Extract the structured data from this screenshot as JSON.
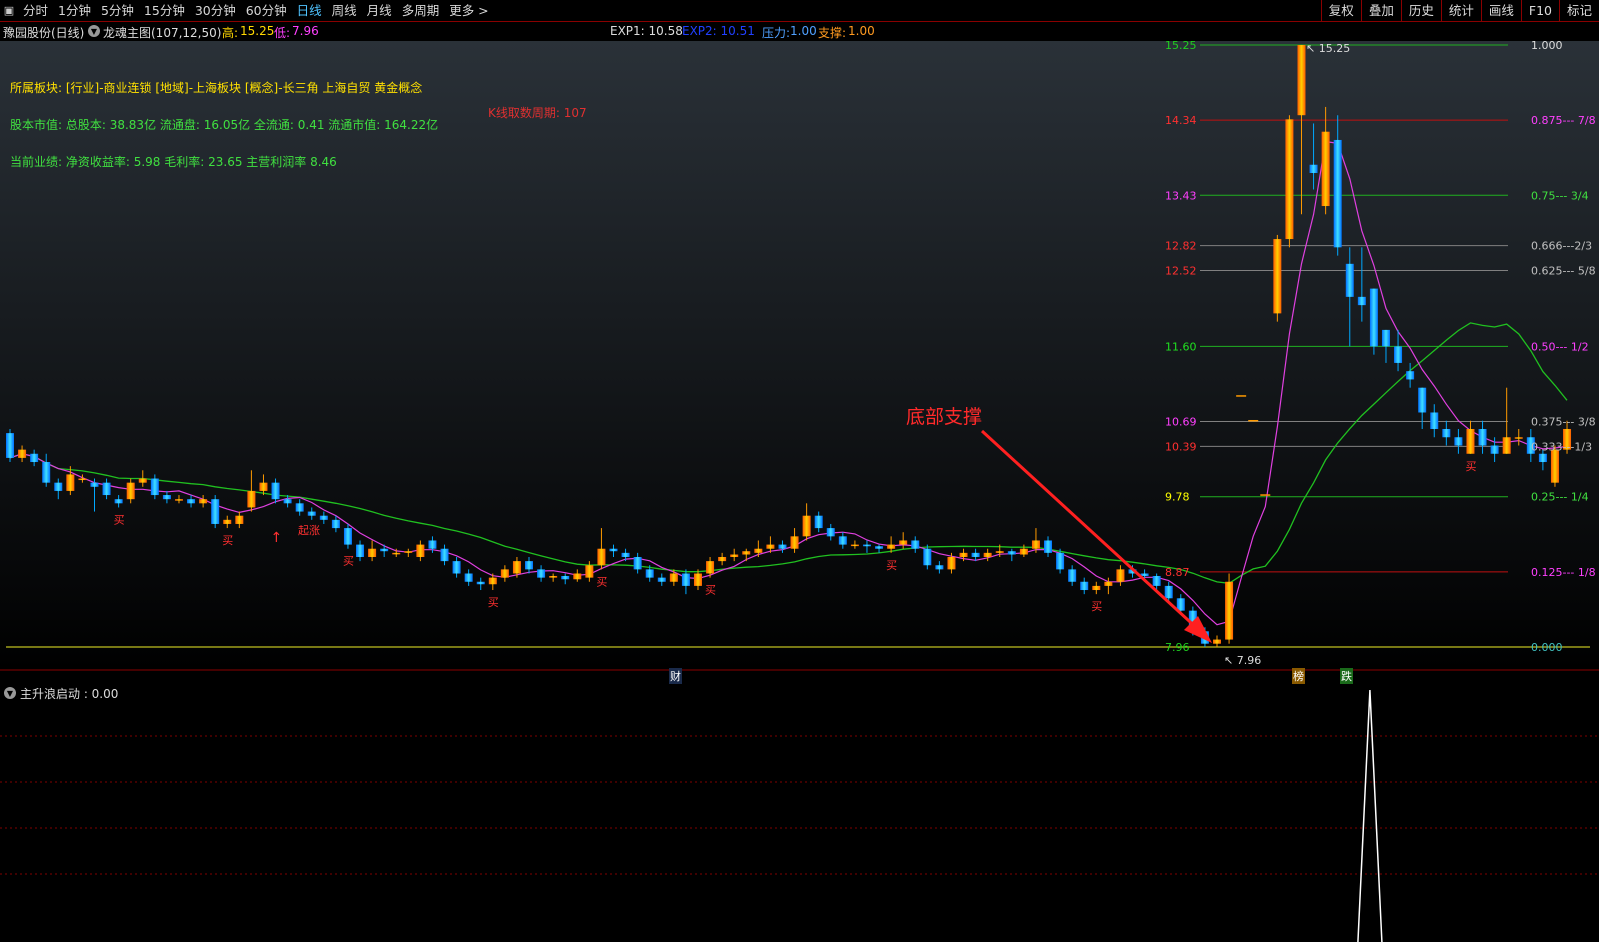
{
  "toolbar": {
    "menu_icon": "▣",
    "tabs": [
      "分时",
      "1分钟",
      "5分钟",
      "15分钟",
      "30分钟",
      "60分钟",
      "日线",
      "周线",
      "月线",
      "多周期",
      "更多 >"
    ],
    "active_tab": "日线",
    "right_buttons": [
      "复权",
      "叠加",
      "历史",
      "统计",
      "画线",
      "F10",
      "标记"
    ]
  },
  "info": {
    "stock_name": "豫园股份(日线)",
    "indicator_name": "龙魂主图(107,12,50)",
    "high_label": "高:",
    "high_value": "15.25",
    "low_label": "低:",
    "low_value": "7.96",
    "exp1": "EXP1: 10.58",
    "exp2": "EXP2: 10.51",
    "pressure_label": "压力:",
    "pressure_value": "1.00",
    "support_label": "支撑:",
    "support_value": "1.00"
  },
  "annotations": {
    "sector": "所属板块: [行业]-商业连锁 [地域]-上海板块 [概念]-长三角 上海自贸 黄金概念",
    "market_cap": "股本市值: 总股本: 38.83亿 流通盘: 16.05亿 全流通: 0.41 流通市值: 164.22亿",
    "performance": "当前业绩: 净资收益率: 5.98 毛利率: 23.65 主营利润率 8.46",
    "kline_count": "K线取数周期: 107",
    "bottom_support": "底部支撑",
    "high_marker": "15.25",
    "low_marker": "7.96",
    "buy_marker": "买",
    "start_marker": "起涨",
    "cai_marker": "财",
    "bang_marker": "榜",
    "die_marker": "跌"
  },
  "indicator": {
    "label": "主升浪启动 : 0.00"
  },
  "colors": {
    "up": "#ff9a00",
    "down": "#00a8ff",
    "ma_short": "#e040e0",
    "ma_long": "#20c020",
    "grid_red": "#c01010",
    "grid_gray": "#808080",
    "grid_green": "#20b020",
    "baseline": "#c0c020"
  },
  "chart_data": {
    "type": "candlestick",
    "y_price_range": [
      7.96,
      15.25
    ],
    "price_levels": [
      {
        "price": "15.25",
        "fib": "1.000"
      },
      {
        "price": "14.34",
        "fib": "0.875--- 7/8"
      },
      {
        "price": "13.43",
        "fib": "0.75--- 3/4"
      },
      {
        "price": "12.82",
        "fib": "0.666---2/3"
      },
      {
        "price": "12.52",
        "fib": "0.625--- 5/8"
      },
      {
        "price": "11.60",
        "fib": "0.50--- 1/2"
      },
      {
        "price": "10.69",
        "fib": "0.375--- 3/8"
      },
      {
        "price": "10.39",
        "fib": "0.333---1/3"
      },
      {
        "price": "9.78",
        "fib": "0.25--- 1/4"
      },
      {
        "price": "8.87",
        "fib": "0.125--- 1/8"
      },
      {
        "price": "7.96",
        "fib": "0.000"
      }
    ],
    "candles": [
      [
        10.55,
        10.25,
        10.6,
        10.2
      ],
      [
        10.25,
        10.35,
        10.4,
        10.2
      ],
      [
        10.3,
        10.2,
        10.35,
        10.15
      ],
      [
        10.2,
        9.95,
        10.3,
        9.9
      ],
      [
        9.95,
        9.85,
        10.0,
        9.75
      ],
      [
        9.85,
        10.05,
        10.15,
        9.8
      ],
      [
        10.0,
        10.0,
        10.05,
        9.95
      ],
      [
        9.95,
        9.9,
        10.0,
        9.6
      ],
      [
        9.95,
        9.8,
        10.0,
        9.75
      ],
      [
        9.75,
        9.7,
        9.8,
        9.65
      ],
      [
        9.75,
        9.95,
        10.0,
        9.7
      ],
      [
        9.95,
        10.0,
        10.1,
        9.9
      ],
      [
        10.0,
        9.8,
        10.05,
        9.75
      ],
      [
        9.8,
        9.75,
        9.85,
        9.7
      ],
      [
        9.75,
        9.75,
        9.8,
        9.7
      ],
      [
        9.75,
        9.7,
        9.8,
        9.65
      ],
      [
        9.7,
        9.75,
        9.8,
        9.65
      ],
      [
        9.75,
        9.45,
        9.8,
        9.4
      ],
      [
        9.45,
        9.5,
        9.55,
        9.4
      ],
      [
        9.45,
        9.55,
        9.6,
        9.4
      ],
      [
        9.65,
        9.85,
        10.1,
        9.6
      ],
      [
        9.85,
        9.95,
        10.05,
        9.8
      ],
      [
        9.95,
        9.75,
        10.0,
        9.7
      ],
      [
        9.75,
        9.7,
        9.8,
        9.65
      ],
      [
        9.7,
        9.6,
        9.75,
        9.55
      ],
      [
        9.6,
        9.55,
        9.65,
        9.5
      ],
      [
        9.55,
        9.5,
        9.6,
        9.45
      ],
      [
        9.5,
        9.4,
        9.55,
        9.35
      ],
      [
        9.4,
        9.2,
        9.45,
        9.15
      ],
      [
        9.2,
        9.05,
        9.25,
        9.0
      ],
      [
        9.05,
        9.15,
        9.25,
        9.0
      ],
      [
        9.15,
        9.12,
        9.2,
        9.05
      ],
      [
        9.1,
        9.1,
        9.15,
        9.05
      ],
      [
        9.1,
        9.12,
        9.15,
        9.05
      ],
      [
        9.05,
        9.2,
        9.25,
        9.0
      ],
      [
        9.25,
        9.15,
        9.3,
        9.1
      ],
      [
        9.15,
        9.0,
        9.2,
        8.95
      ],
      [
        9.0,
        8.85,
        9.05,
        8.8
      ],
      [
        8.85,
        8.75,
        8.9,
        8.7
      ],
      [
        8.75,
        8.72,
        8.8,
        8.65
      ],
      [
        8.72,
        8.8,
        8.85,
        8.65
      ],
      [
        8.8,
        8.9,
        8.95,
        8.75
      ],
      [
        8.85,
        9.0,
        9.05,
        8.8
      ],
      [
        9.0,
        8.9,
        9.05,
        8.85
      ],
      [
        8.9,
        8.8,
        8.95,
        8.75
      ],
      [
        8.8,
        8.82,
        8.85,
        8.75
      ],
      [
        8.82,
        8.78,
        8.85,
        8.72
      ],
      [
        8.78,
        8.85,
        8.9,
        8.75
      ],
      [
        8.8,
        8.95,
        9.0,
        8.75
      ],
      [
        8.95,
        9.15,
        9.4,
        8.9
      ],
      [
        9.15,
        9.12,
        9.2,
        9.05
      ],
      [
        9.1,
        9.05,
        9.15,
        9.0
      ],
      [
        9.05,
        8.9,
        9.1,
        8.85
      ],
      [
        8.9,
        8.8,
        8.95,
        8.75
      ],
      [
        8.8,
        8.75,
        8.85,
        8.7
      ],
      [
        8.75,
        8.85,
        8.9,
        8.7
      ],
      [
        8.85,
        8.7,
        8.9,
        8.6
      ],
      [
        8.7,
        8.85,
        8.9,
        8.65
      ],
      [
        8.85,
        9.0,
        9.05,
        8.8
      ],
      [
        9.0,
        9.05,
        9.1,
        8.95
      ],
      [
        9.05,
        9.08,
        9.15,
        9.0
      ],
      [
        9.08,
        9.12,
        9.15,
        9.0
      ],
      [
        9.1,
        9.15,
        9.25,
        9.05
      ],
      [
        9.15,
        9.2,
        9.3,
        9.1
      ],
      [
        9.2,
        9.15,
        9.25,
        9.1
      ],
      [
        9.15,
        9.3,
        9.4,
        9.1
      ],
      [
        9.3,
        9.55,
        9.7,
        9.25
      ],
      [
        9.55,
        9.4,
        9.6,
        9.35
      ],
      [
        9.4,
        9.3,
        9.45,
        9.25
      ],
      [
        9.3,
        9.2,
        9.35,
        9.15
      ],
      [
        9.2,
        9.2,
        9.25,
        9.15
      ],
      [
        9.2,
        9.18,
        9.25,
        9.1
      ],
      [
        9.18,
        9.15,
        9.2,
        9.1
      ],
      [
        9.15,
        9.2,
        9.3,
        9.1
      ],
      [
        9.2,
        9.25,
        9.35,
        9.15
      ],
      [
        9.25,
        9.15,
        9.3,
        9.1
      ],
      [
        9.15,
        8.95,
        9.2,
        8.9
      ],
      [
        8.95,
        8.9,
        9.0,
        8.85
      ],
      [
        8.9,
        9.05,
        9.1,
        8.85
      ],
      [
        9.05,
        9.1,
        9.15,
        9.0
      ],
      [
        9.1,
        9.05,
        9.15,
        9.0
      ],
      [
        9.05,
        9.1,
        9.15,
        9.0
      ],
      [
        9.1,
        9.12,
        9.2,
        9.05
      ],
      [
        9.12,
        9.08,
        9.15,
        9.0
      ],
      [
        9.08,
        9.15,
        9.2,
        9.05
      ],
      [
        9.15,
        9.25,
        9.4,
        9.1
      ],
      [
        9.25,
        9.1,
        9.3,
        9.05
      ],
      [
        9.1,
        8.9,
        9.15,
        8.85
      ],
      [
        8.9,
        8.75,
        8.95,
        8.7
      ],
      [
        8.75,
        8.65,
        8.8,
        8.6
      ],
      [
        8.65,
        8.7,
        8.75,
        8.6
      ],
      [
        8.7,
        8.75,
        8.8,
        8.6
      ],
      [
        8.75,
        8.9,
        8.95,
        8.7
      ],
      [
        8.9,
        8.85,
        8.95,
        8.8
      ],
      [
        8.85,
        8.82,
        8.9,
        8.75
      ],
      [
        8.82,
        8.7,
        8.85,
        8.65
      ],
      [
        8.7,
        8.55,
        8.75,
        8.5
      ],
      [
        8.55,
        8.4,
        8.6,
        8.35
      ],
      [
        8.4,
        8.15,
        8.45,
        8.1
      ],
      [
        8.15,
        8.0,
        8.2,
        7.96
      ],
      [
        8.0,
        8.05,
        8.1,
        7.96
      ],
      [
        8.05,
        8.75,
        8.85,
        8.0
      ],
      [
        11.0,
        11.0,
        11.0,
        11.0
      ],
      [
        10.7,
        10.7,
        10.7,
        10.7
      ],
      [
        9.8,
        9.8,
        9.8,
        9.8
      ],
      [
        12.0,
        12.9,
        12.95,
        11.9
      ],
      [
        12.9,
        14.35,
        14.4,
        12.8
      ],
      [
        14.4,
        15.25,
        15.25,
        13.2
      ],
      [
        13.8,
        13.7,
        14.3,
        13.5
      ],
      [
        13.3,
        14.2,
        14.5,
        13.2
      ],
      [
        14.1,
        12.8,
        14.4,
        12.7
      ],
      [
        12.6,
        12.2,
        12.8,
        11.6
      ],
      [
        12.2,
        12.1,
        12.8,
        11.9
      ],
      [
        12.3,
        11.6,
        12.3,
        11.5
      ],
      [
        11.8,
        11.6,
        11.8,
        11.4
      ],
      [
        11.6,
        11.4,
        11.8,
        11.3
      ],
      [
        11.3,
        11.2,
        11.4,
        11.1
      ],
      [
        11.1,
        10.8,
        11.1,
        10.6
      ],
      [
        10.8,
        10.6,
        10.9,
        10.5
      ],
      [
        10.6,
        10.5,
        10.7,
        10.4
      ],
      [
        10.5,
        10.4,
        10.6,
        10.3
      ],
      [
        10.3,
        10.6,
        10.7,
        10.3
      ],
      [
        10.6,
        10.4,
        10.7,
        10.3
      ],
      [
        10.4,
        10.3,
        10.5,
        10.2
      ],
      [
        10.3,
        10.5,
        11.1,
        10.3
      ],
      [
        10.5,
        10.5,
        10.6,
        10.4
      ],
      [
        10.5,
        10.3,
        10.6,
        10.2
      ],
      [
        10.3,
        10.2,
        10.35,
        10.1
      ],
      [
        9.95,
        10.35,
        10.4,
        9.9
      ],
      [
        10.35,
        10.6,
        10.7,
        10.3
      ]
    ],
    "indicator_series": {
      "name": "主升浪启动",
      "spike_index": 113,
      "spike_value": 1.0,
      "y_range": [
        0,
        1.0
      ]
    }
  }
}
